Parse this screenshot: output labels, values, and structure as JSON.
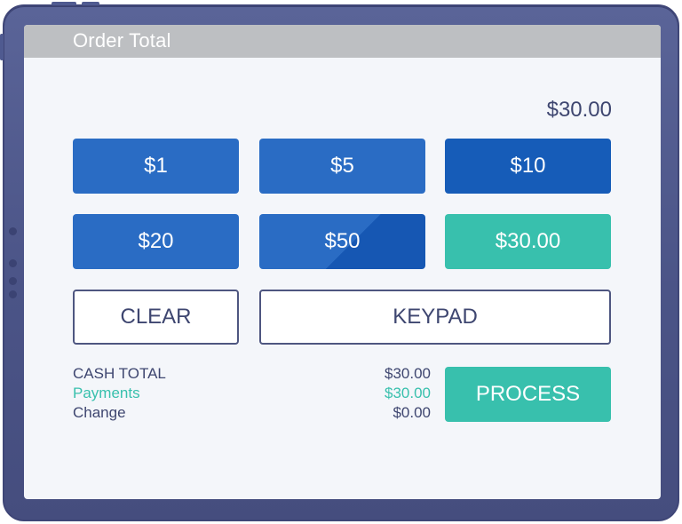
{
  "header": {
    "title": "Order Total"
  },
  "order": {
    "amount": "$30.00"
  },
  "quick_cash": {
    "b1": "$1",
    "b5": "$5",
    "b10": "$10",
    "b20": "$20",
    "b50": "$50",
    "exact": "$30.00"
  },
  "actions": {
    "clear": "CLEAR",
    "keypad": "KEYPAD",
    "process": "PROCESS"
  },
  "summary": {
    "cash_total_label": "CASH TOTAL",
    "cash_total_value": "$30.00",
    "payments_label": "Payments",
    "payments_value": "$30.00",
    "change_label": "Change",
    "change_value": "$0.00"
  },
  "colors": {
    "primary_blue": "#2a6cc4",
    "accent_teal": "#38c0ad",
    "text_navy": "#3e4670",
    "device_frame": "#4b5487"
  }
}
